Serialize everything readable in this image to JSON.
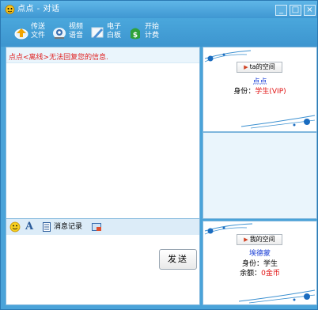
{
  "window": {
    "title": "点点 - 对话",
    "controls": {
      "minimize": "_",
      "maximize": "□",
      "close": "×"
    }
  },
  "toolbar": {
    "items": [
      {
        "label": "传送\n文件",
        "icon": "file-transfer-icon"
      },
      {
        "label": "视频\n语音",
        "icon": "video-voice-icon"
      },
      {
        "label": "电子\n白板",
        "icon": "whiteboard-icon"
      },
      {
        "label": "开始\n计费",
        "icon": "billing-icon"
      }
    ]
  },
  "chat": {
    "status_message": "点点<离线>无法回复您的信息."
  },
  "input_toolbar": {
    "history_label": "消息记录"
  },
  "input": {
    "send_label": "发送"
  },
  "contact_panel": {
    "space_button": "ta的空间",
    "name": "点点",
    "identity_label": "身份：",
    "identity_value": "学生(VIP)"
  },
  "self_panel": {
    "space_button": "我的空间",
    "name": "埃德蒙",
    "identity_label": "身份：",
    "identity_value": "学生",
    "balance_label": "余额：",
    "balance_value": "0金币"
  },
  "colors": {
    "frame": "#4aa3d9",
    "alert_text": "#e02020",
    "name_text": "#1a3fd6"
  }
}
